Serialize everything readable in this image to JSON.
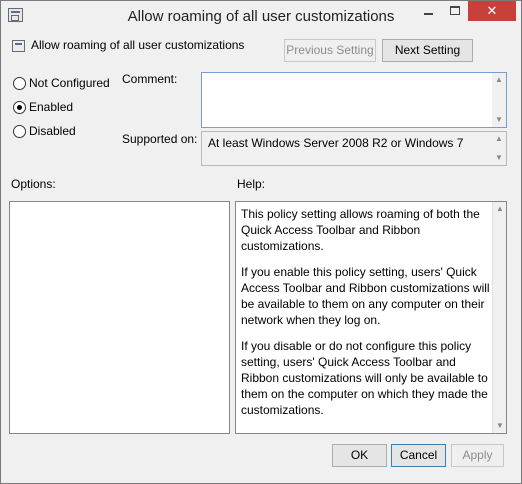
{
  "window": {
    "title": "Allow roaming of all user customizations",
    "caption": {
      "minimize_glyph": "",
      "maximize_glyph": "",
      "close_glyph": "✕"
    }
  },
  "header": {
    "policy_name": "Allow roaming of all user customizations",
    "previous_setting_label": "Previous Setting",
    "next_setting_label": "Next Setting"
  },
  "state_options": [
    {
      "label": "Not Configured",
      "checked": false
    },
    {
      "label": "Enabled",
      "checked": true
    },
    {
      "label": "Disabled",
      "checked": false
    }
  ],
  "comment": {
    "label": "Comment:",
    "value": ""
  },
  "supported_on": {
    "label": "Supported on:",
    "value": "At least Windows Server 2008 R2 or Windows 7"
  },
  "options": {
    "label": "Options:"
  },
  "help": {
    "label": "Help:",
    "paragraphs": [
      "This policy setting allows roaming of both the Quick Access Toolbar and Ribbon customizations.",
      "If you enable this policy setting, users' Quick Access Toolbar and Ribbon customizations will be available to them on any computer on their network when they log on.",
      "If you disable or do not configure this policy setting, users' Quick Access Toolbar and Ribbon customizations will only be available to them on the computer on which they made the customizations."
    ]
  },
  "footer": {
    "ok_label": "OK",
    "cancel_label": "Cancel",
    "apply_label": "Apply"
  },
  "colors": {
    "close_button": "#c7413a",
    "focus_border": "#3c7fb1",
    "comment_border": "#7a9cd3"
  }
}
